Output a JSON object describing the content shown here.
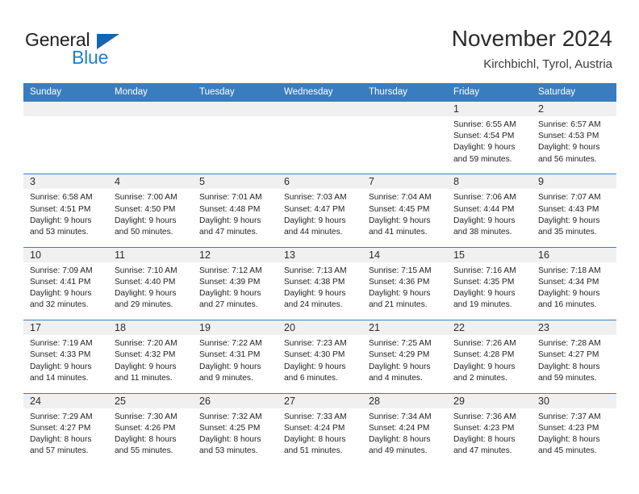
{
  "brand": {
    "name_part1": "General",
    "name_part2": "Blue"
  },
  "header": {
    "title": "November 2024",
    "subtitle": "Kirchbichl, Tyrol, Austria"
  },
  "colors": {
    "header_blue": "#3a7dbf",
    "logo_blue": "#1c7fd0",
    "day_strip_gray": "#f0f0f0"
  },
  "weekdays": [
    "Sunday",
    "Monday",
    "Tuesday",
    "Wednesday",
    "Thursday",
    "Friday",
    "Saturday"
  ],
  "weeks": [
    [
      {
        "day": "",
        "empty": true
      },
      {
        "day": "",
        "empty": true
      },
      {
        "day": "",
        "empty": true
      },
      {
        "day": "",
        "empty": true
      },
      {
        "day": "",
        "empty": true
      },
      {
        "day": "1",
        "sunrise": "Sunrise: 6:55 AM",
        "sunset": "Sunset: 4:54 PM",
        "daylight1": "Daylight: 9 hours",
        "daylight2": "and 59 minutes."
      },
      {
        "day": "2",
        "sunrise": "Sunrise: 6:57 AM",
        "sunset": "Sunset: 4:53 PM",
        "daylight1": "Daylight: 9 hours",
        "daylight2": "and 56 minutes."
      }
    ],
    [
      {
        "day": "3",
        "sunrise": "Sunrise: 6:58 AM",
        "sunset": "Sunset: 4:51 PM",
        "daylight1": "Daylight: 9 hours",
        "daylight2": "and 53 minutes."
      },
      {
        "day": "4",
        "sunrise": "Sunrise: 7:00 AM",
        "sunset": "Sunset: 4:50 PM",
        "daylight1": "Daylight: 9 hours",
        "daylight2": "and 50 minutes."
      },
      {
        "day": "5",
        "sunrise": "Sunrise: 7:01 AM",
        "sunset": "Sunset: 4:48 PM",
        "daylight1": "Daylight: 9 hours",
        "daylight2": "and 47 minutes."
      },
      {
        "day": "6",
        "sunrise": "Sunrise: 7:03 AM",
        "sunset": "Sunset: 4:47 PM",
        "daylight1": "Daylight: 9 hours",
        "daylight2": "and 44 minutes."
      },
      {
        "day": "7",
        "sunrise": "Sunrise: 7:04 AM",
        "sunset": "Sunset: 4:45 PM",
        "daylight1": "Daylight: 9 hours",
        "daylight2": "and 41 minutes."
      },
      {
        "day": "8",
        "sunrise": "Sunrise: 7:06 AM",
        "sunset": "Sunset: 4:44 PM",
        "daylight1": "Daylight: 9 hours",
        "daylight2": "and 38 minutes."
      },
      {
        "day": "9",
        "sunrise": "Sunrise: 7:07 AM",
        "sunset": "Sunset: 4:43 PM",
        "daylight1": "Daylight: 9 hours",
        "daylight2": "and 35 minutes."
      }
    ],
    [
      {
        "day": "10",
        "sunrise": "Sunrise: 7:09 AM",
        "sunset": "Sunset: 4:41 PM",
        "daylight1": "Daylight: 9 hours",
        "daylight2": "and 32 minutes."
      },
      {
        "day": "11",
        "sunrise": "Sunrise: 7:10 AM",
        "sunset": "Sunset: 4:40 PM",
        "daylight1": "Daylight: 9 hours",
        "daylight2": "and 29 minutes."
      },
      {
        "day": "12",
        "sunrise": "Sunrise: 7:12 AM",
        "sunset": "Sunset: 4:39 PM",
        "daylight1": "Daylight: 9 hours",
        "daylight2": "and 27 minutes."
      },
      {
        "day": "13",
        "sunrise": "Sunrise: 7:13 AM",
        "sunset": "Sunset: 4:38 PM",
        "daylight1": "Daylight: 9 hours",
        "daylight2": "and 24 minutes."
      },
      {
        "day": "14",
        "sunrise": "Sunrise: 7:15 AM",
        "sunset": "Sunset: 4:36 PM",
        "daylight1": "Daylight: 9 hours",
        "daylight2": "and 21 minutes."
      },
      {
        "day": "15",
        "sunrise": "Sunrise: 7:16 AM",
        "sunset": "Sunset: 4:35 PM",
        "daylight1": "Daylight: 9 hours",
        "daylight2": "and 19 minutes."
      },
      {
        "day": "16",
        "sunrise": "Sunrise: 7:18 AM",
        "sunset": "Sunset: 4:34 PM",
        "daylight1": "Daylight: 9 hours",
        "daylight2": "and 16 minutes."
      }
    ],
    [
      {
        "day": "17",
        "sunrise": "Sunrise: 7:19 AM",
        "sunset": "Sunset: 4:33 PM",
        "daylight1": "Daylight: 9 hours",
        "daylight2": "and 14 minutes."
      },
      {
        "day": "18",
        "sunrise": "Sunrise: 7:20 AM",
        "sunset": "Sunset: 4:32 PM",
        "daylight1": "Daylight: 9 hours",
        "daylight2": "and 11 minutes."
      },
      {
        "day": "19",
        "sunrise": "Sunrise: 7:22 AM",
        "sunset": "Sunset: 4:31 PM",
        "daylight1": "Daylight: 9 hours",
        "daylight2": "and 9 minutes."
      },
      {
        "day": "20",
        "sunrise": "Sunrise: 7:23 AM",
        "sunset": "Sunset: 4:30 PM",
        "daylight1": "Daylight: 9 hours",
        "daylight2": "and 6 minutes."
      },
      {
        "day": "21",
        "sunrise": "Sunrise: 7:25 AM",
        "sunset": "Sunset: 4:29 PM",
        "daylight1": "Daylight: 9 hours",
        "daylight2": "and 4 minutes."
      },
      {
        "day": "22",
        "sunrise": "Sunrise: 7:26 AM",
        "sunset": "Sunset: 4:28 PM",
        "daylight1": "Daylight: 9 hours",
        "daylight2": "and 2 minutes."
      },
      {
        "day": "23",
        "sunrise": "Sunrise: 7:28 AM",
        "sunset": "Sunset: 4:27 PM",
        "daylight1": "Daylight: 8 hours",
        "daylight2": "and 59 minutes."
      }
    ],
    [
      {
        "day": "24",
        "sunrise": "Sunrise: 7:29 AM",
        "sunset": "Sunset: 4:27 PM",
        "daylight1": "Daylight: 8 hours",
        "daylight2": "and 57 minutes."
      },
      {
        "day": "25",
        "sunrise": "Sunrise: 7:30 AM",
        "sunset": "Sunset: 4:26 PM",
        "daylight1": "Daylight: 8 hours",
        "daylight2": "and 55 minutes."
      },
      {
        "day": "26",
        "sunrise": "Sunrise: 7:32 AM",
        "sunset": "Sunset: 4:25 PM",
        "daylight1": "Daylight: 8 hours",
        "daylight2": "and 53 minutes."
      },
      {
        "day": "27",
        "sunrise": "Sunrise: 7:33 AM",
        "sunset": "Sunset: 4:24 PM",
        "daylight1": "Daylight: 8 hours",
        "daylight2": "and 51 minutes."
      },
      {
        "day": "28",
        "sunrise": "Sunrise: 7:34 AM",
        "sunset": "Sunset: 4:24 PM",
        "daylight1": "Daylight: 8 hours",
        "daylight2": "and 49 minutes."
      },
      {
        "day": "29",
        "sunrise": "Sunrise: 7:36 AM",
        "sunset": "Sunset: 4:23 PM",
        "daylight1": "Daylight: 8 hours",
        "daylight2": "and 47 minutes."
      },
      {
        "day": "30",
        "sunrise": "Sunrise: 7:37 AM",
        "sunset": "Sunset: 4:23 PM",
        "daylight1": "Daylight: 8 hours",
        "daylight2": "and 45 minutes."
      }
    ]
  ]
}
